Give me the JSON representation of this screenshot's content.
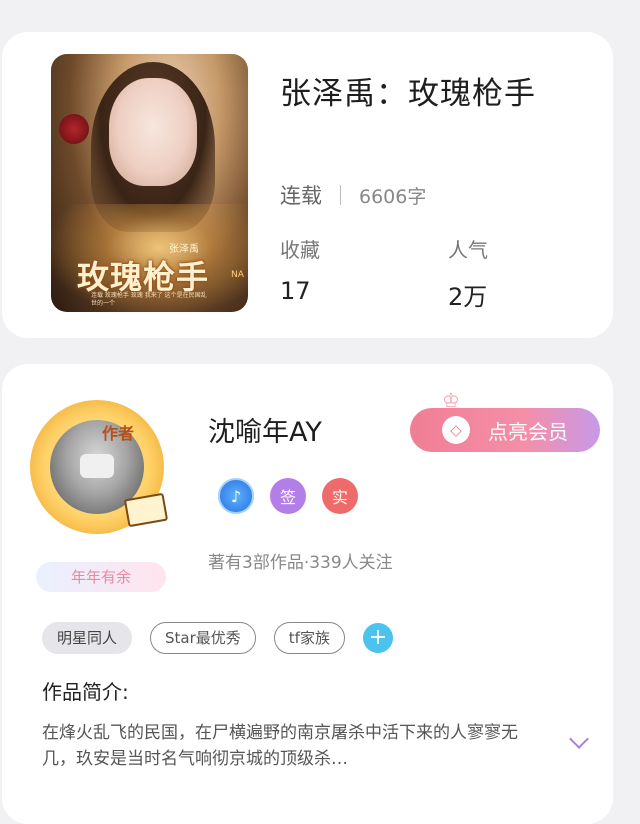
{
  "book": {
    "title": "张泽禹：玫瑰枪手",
    "cover": {
      "author": "张泽禹",
      "title": "玫瑰枪手",
      "tag": "NA",
      "blurb": "连载 玫瑰枪手 玫瑰 我来了 这个是在民国乱世的一个"
    },
    "status": "连载",
    "word_count": "6606字",
    "stats": [
      {
        "label": "收藏",
        "value": "17"
      },
      {
        "label": "人气",
        "value": "2万"
      }
    ]
  },
  "author": {
    "name": "沈喻年AY",
    "avatar_badge": "作者",
    "decor_ribbon": "年年有余",
    "member_button": "点亮会员",
    "badges": [
      {
        "icon": "music-note-icon",
        "text": "♪"
      },
      {
        "icon": "sign-icon",
        "text": "签"
      },
      {
        "icon": "verified-icon",
        "text": "实"
      }
    ],
    "stats": "著有3部作品·339人关注"
  },
  "tags": [
    "明星同人",
    "Star最优秀",
    "tf家族"
  ],
  "intro": {
    "title": "作品简介:",
    "text": "在烽火乱飞的民国，在尸横遍野的南京屠杀中活下来的人寥寥无几，玖安是当时名气响彻京城的顶级杀…"
  },
  "colors": {
    "accent_pink": "#f07e94",
    "accent_purple": "#b47ee8",
    "accent_blue": "#4cc2ee",
    "badge_red": "#ee6b6b"
  }
}
